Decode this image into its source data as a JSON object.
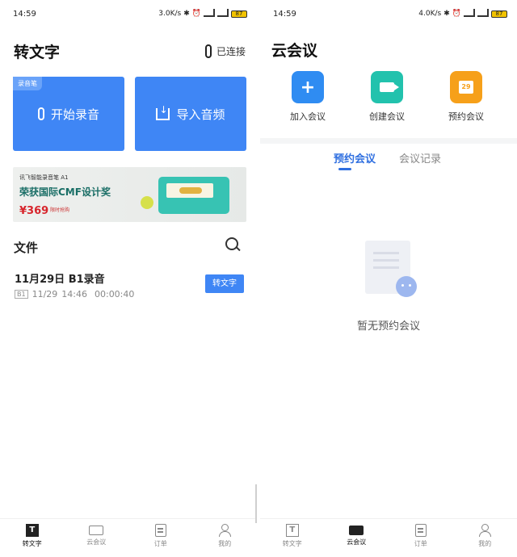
{
  "left": {
    "status": {
      "time": "14:59",
      "speed": "3.0K/s",
      "battery": "87"
    },
    "title": "转文字",
    "connected": "已连接",
    "cards": {
      "record_tag": "录音笔",
      "record_label": "开始录音",
      "import_label": "导入音频"
    },
    "banner": {
      "line1": "讯飞智能录音笔 A1",
      "line2": "荣获国际CMF设计奖",
      "price": "¥369",
      "promo": "限时抢购"
    },
    "files": {
      "section_title": "文件",
      "item": {
        "title": "11月29日 B1录音",
        "tag": "B1",
        "date": "11/29",
        "time": "14:46",
        "duration": "00:00:40",
        "action": "转文字"
      }
    },
    "nav": [
      {
        "label": "转文字",
        "icon": "text-icon",
        "active": true
      },
      {
        "label": "云会议",
        "icon": "video-icon",
        "active": false
      },
      {
        "label": "订单",
        "icon": "order-icon",
        "active": false
      },
      {
        "label": "我的",
        "icon": "user-icon",
        "active": false
      }
    ]
  },
  "right": {
    "status": {
      "time": "14:59",
      "speed": "4.0K/s",
      "battery": "87"
    },
    "title": "云会议",
    "quick_actions": [
      {
        "label": "加入会议",
        "icon": "plus-icon",
        "color": "#2f8cf2"
      },
      {
        "label": "创建会议",
        "icon": "video-camera-icon",
        "color": "#22c2ad"
      },
      {
        "label": "预约会议",
        "icon": "calendar-icon",
        "color": "#f6a01a",
        "cal_day": "29"
      }
    ],
    "tabs": [
      {
        "label": "预约会议",
        "active": true
      },
      {
        "label": "会议记录",
        "active": false
      }
    ],
    "empty_text": "暂无预约会议",
    "nav": [
      {
        "label": "转文字",
        "icon": "text-icon",
        "active": false
      },
      {
        "label": "云会议",
        "icon": "video-icon",
        "active": true
      },
      {
        "label": "订单",
        "icon": "order-icon",
        "active": false
      },
      {
        "label": "我的",
        "icon": "user-icon",
        "active": false
      }
    ]
  },
  "colors": {
    "accent": "#3f86f5",
    "tab_active": "#2f6fe0"
  }
}
